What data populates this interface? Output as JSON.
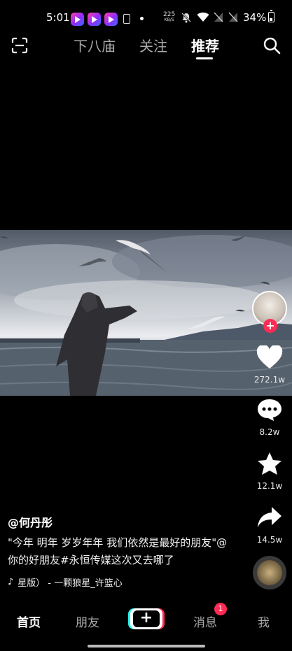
{
  "status_bar": {
    "time": "5:01",
    "net_speed": "225",
    "net_speed_unit": "KB/S",
    "battery": "34%"
  },
  "top_nav": {
    "tabs": [
      "下八庙",
      "关注",
      "推荐"
    ],
    "active_tab": "推荐"
  },
  "video": {
    "description_icons": [
      "scan-icon",
      "search-icon"
    ]
  },
  "side_actions": {
    "like_count": "272.1w",
    "comment_count": "8.2w",
    "favorite_count": "12.1w",
    "share_count": "14.5w"
  },
  "post": {
    "author": "@何丹彤",
    "caption": "\"今年 明年 岁岁年年 我们依然是最好的朋友\"@你的好朋友#永恒传媒这次又去哪了",
    "music": "星版） - 一颗狼星_许篮心"
  },
  "bottom_nav": {
    "home": "首页",
    "friends": "朋友",
    "create": "+",
    "messages": "消息",
    "messages_badge": "1",
    "me": "我"
  }
}
